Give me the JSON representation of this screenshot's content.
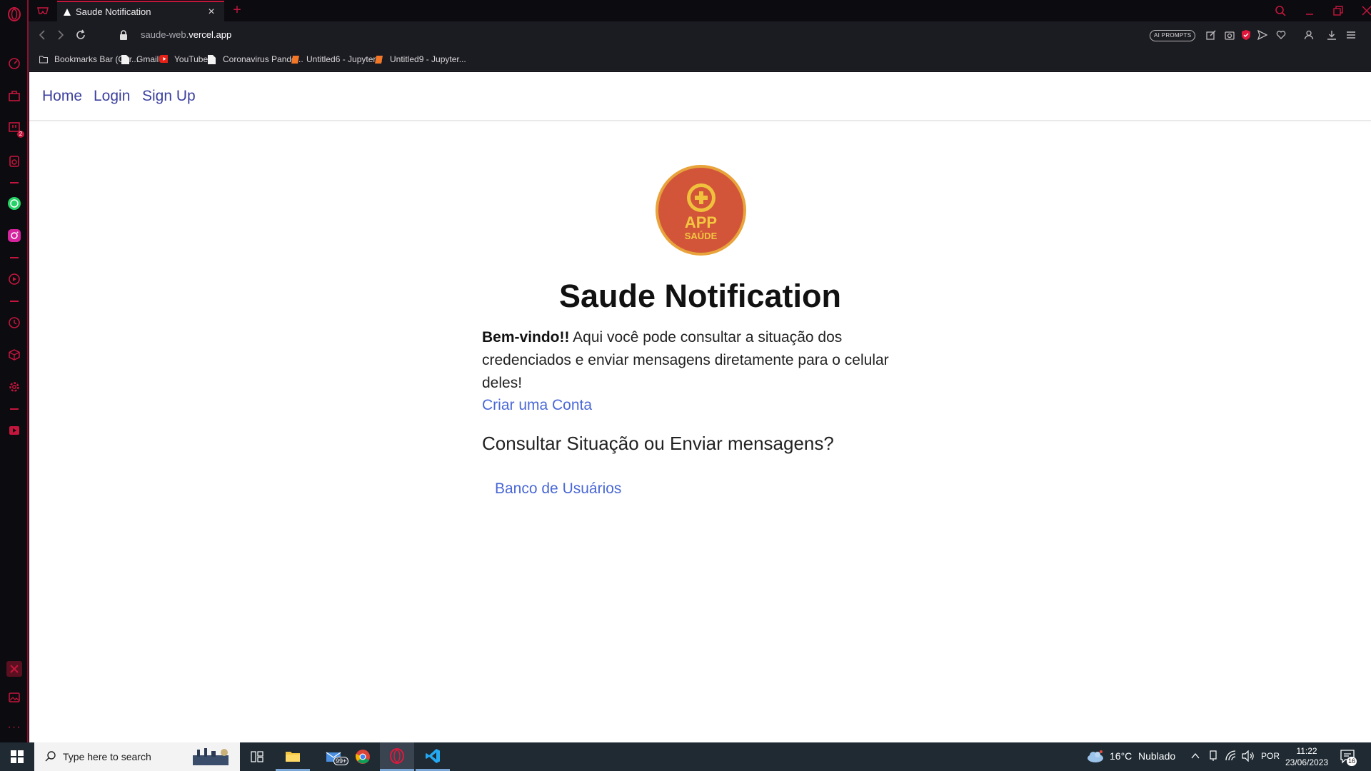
{
  "browser": {
    "tab_title": "Saude Notification",
    "new_tab": "+",
    "tab_close": "×",
    "url_prefix": "saude-web.",
    "url_domain": "vercel.app",
    "ai_prompts": "AI PROMPTS",
    "sidebar_badge": "2",
    "bookmarks": [
      {
        "label": "Bookmarks Bar (Chr...",
        "icon": "folder-icon"
      },
      {
        "label": "Gmail",
        "icon": "page-icon"
      },
      {
        "label": "YouTube",
        "icon": "youtube-icon"
      },
      {
        "label": "Coronavirus Pande...",
        "icon": "page-icon"
      },
      {
        "label": "Untitled6 - Jupyter...",
        "icon": "jupyter-icon"
      },
      {
        "label": "Untitled9 - Jupyter...",
        "icon": "jupyter-icon"
      }
    ],
    "accent": "#c4163c"
  },
  "site": {
    "nav": {
      "home": "Home",
      "login": "Login",
      "signup": "Sign Up"
    },
    "logo": {
      "line1": "APP",
      "line2": "SAÚDE"
    },
    "title": "Saude Notification",
    "welcome_bold": "Bem-vindo!!",
    "welcome_text": " Aqui você pode consultar a situação dos credenciados e enviar mensagens diretamente para o celular deles!",
    "create_account": "Criar uma Conta",
    "question": "Consultar Situação ou Enviar mensagens?",
    "users_link": "Banco de Usuários",
    "link_color": "#4a68d6",
    "nav_color": "#3b3f9e"
  },
  "taskbar": {
    "search_placeholder": "Type here to search",
    "mail_badge": "99+",
    "weather_temp": "16°C",
    "weather_desc": "Nublado",
    "language": "POR",
    "time": "11:22",
    "date": "23/06/2023",
    "notifications": "16"
  }
}
